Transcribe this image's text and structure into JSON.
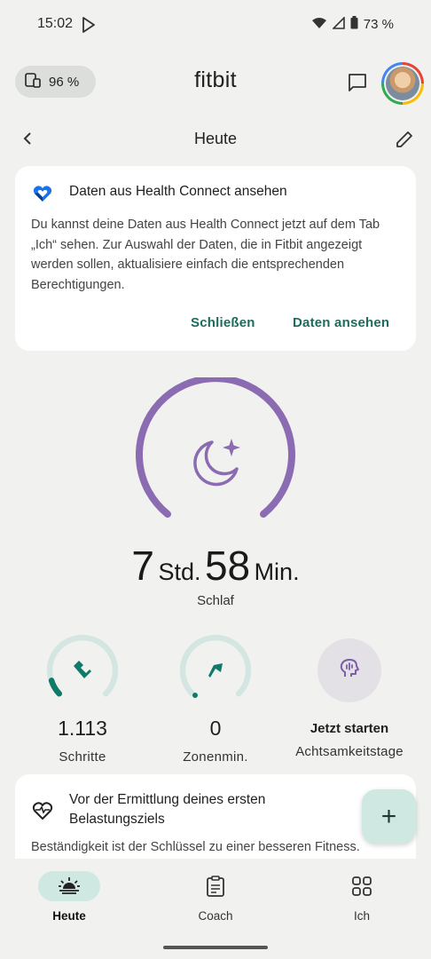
{
  "status_bar": {
    "time": "15:02",
    "battery_percent": "73 %",
    "icons": [
      "play-store-icon",
      "wifi-icon",
      "signal-icon",
      "battery-icon"
    ]
  },
  "header": {
    "device_battery": "96 %",
    "app_title": "fitbit",
    "icons": [
      "device-battery-icon",
      "chat-icon",
      "avatar"
    ]
  },
  "subheader": {
    "title": "Heute",
    "icons": [
      "back-arrow-icon",
      "edit-pencil-icon"
    ]
  },
  "health_connect_card": {
    "title": "Daten aus Health Connect ansehen",
    "body": "Du kannst deine Daten aus Health Connect jetzt auf dem Tab „Ich“ sehen. Zur Auswahl der Daten, die in Fitbit angezeigt werden sollen, aktualisiere einfach die entsprechenden Berechtigungen.",
    "close_label": "Schließen",
    "view_label": "Daten ansehen",
    "icon": "health-connect-icon"
  },
  "sleep": {
    "hours": "7",
    "hours_unit": "Std.",
    "minutes": "58",
    "minutes_unit": "Min.",
    "label": "Schlaf",
    "icon": "moon-stars-icon",
    "ring_color": "#8b6bb1"
  },
  "stats": [
    {
      "value": "1.113",
      "label": "Schritte",
      "icon": "shoe-icon",
      "progress": 0.1
    },
    {
      "value": "0",
      "label": "Zonenmin.",
      "icon": "zone-arrow-icon",
      "progress": 0
    }
  ],
  "mindfulness": {
    "title": "Jetzt starten",
    "label": "Achtsamkeitstage",
    "icon": "mind-head-icon"
  },
  "load_card": {
    "title": "Vor der Ermittlung deines ersten Belastungsziels",
    "body": "Beständigkeit ist der Schlüssel zu einer besseren Fitness.",
    "icon": "heart-wave-icon"
  },
  "fab": {
    "label": "+"
  },
  "nav": [
    {
      "label": "Heute",
      "icon": "sunrise-icon",
      "active": true
    },
    {
      "label": "Coach",
      "icon": "clipboard-icon",
      "active": false
    },
    {
      "label": "Ich",
      "icon": "grid-icon",
      "active": false
    }
  ],
  "colors": {
    "accent": "#1c6b5c",
    "ring_track": "#d3e6e1",
    "ring_progress": "#0f7a6a",
    "sleep": "#8b6bb1"
  }
}
